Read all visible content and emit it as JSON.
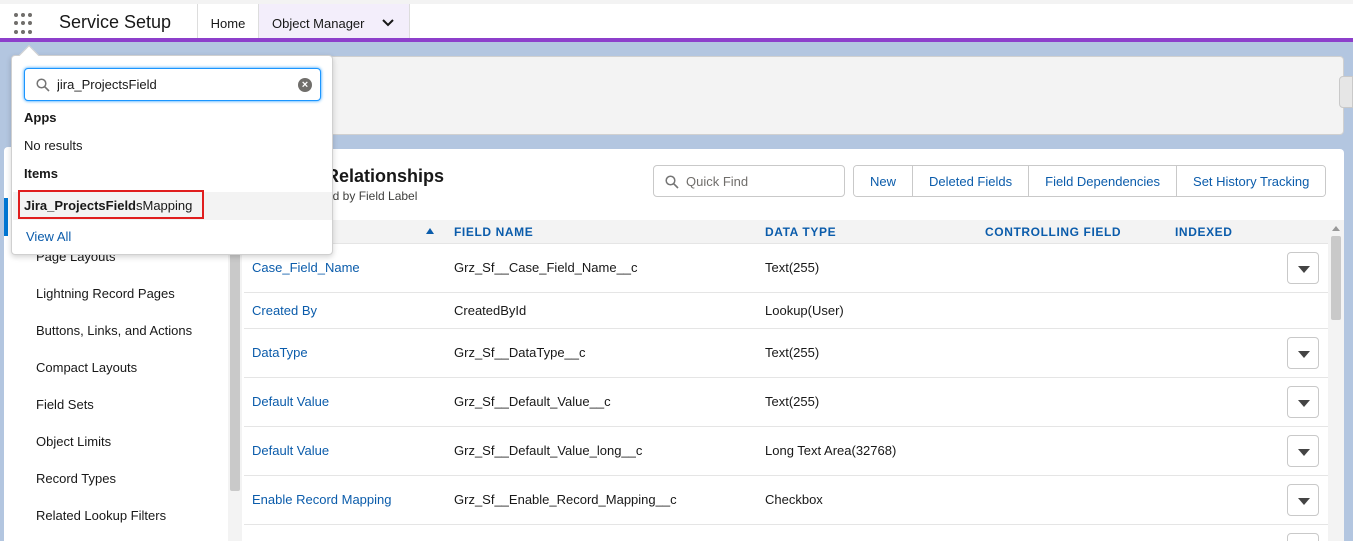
{
  "app": {
    "name": "Service Setup"
  },
  "tabs": [
    {
      "label": "Home"
    },
    {
      "label": "Object Manager"
    }
  ],
  "colors": {
    "accent": "#8d3fcb",
    "link": "#0b5cab",
    "highlight_box": "#e01e1e"
  },
  "search_dropdown": {
    "query": "jira_ProjectsField",
    "apps_heading": "Apps",
    "apps_empty": "No results",
    "items_heading": "Items",
    "item_match": "Jira_ProjectsField",
    "item_rest": "sMapping",
    "view_all": "View All"
  },
  "left_nav": {
    "items": [
      "Page Layouts",
      "Lightning Record Pages",
      "Buttons, Links, and Actions",
      "Compact Layouts",
      "Field Sets",
      "Object Limits",
      "Record Types",
      "Related Lookup Filters"
    ]
  },
  "main": {
    "title": "Relationships",
    "subtitle": "ed by Field Label",
    "quick_find_placeholder": "Quick Find",
    "buttons": [
      "New",
      "Deleted Fields",
      "Field Dependencies",
      "Set History Tracking"
    ],
    "columns": {
      "field_name": "FIELD NAME",
      "data_type": "DATA TYPE",
      "controlling_field": "CONTROLLING FIELD",
      "indexed": "INDEXED"
    },
    "rows": [
      {
        "label": "Case_Field_Name",
        "api": "Grz_Sf__Case_Field_Name__c",
        "type": "Text(255)",
        "has_action": true
      },
      {
        "label": "Created By",
        "api": "CreatedById",
        "type": "Lookup(User)",
        "has_action": false
      },
      {
        "label": "DataType",
        "api": "Grz_Sf__DataType__c",
        "type": "Text(255)",
        "has_action": true
      },
      {
        "label": "Default Value",
        "api": "Grz_Sf__Default_Value__c",
        "type": "Text(255)",
        "has_action": true
      },
      {
        "label": "Default Value",
        "api": "Grz_Sf__Default_Value_long__c",
        "type": "Long Text Area(32768)",
        "has_action": true
      },
      {
        "label": "Enable Record Mapping",
        "api": "Grz_Sf__Enable_Record_Mapping__c",
        "type": "Checkbox",
        "has_action": true
      }
    ]
  }
}
